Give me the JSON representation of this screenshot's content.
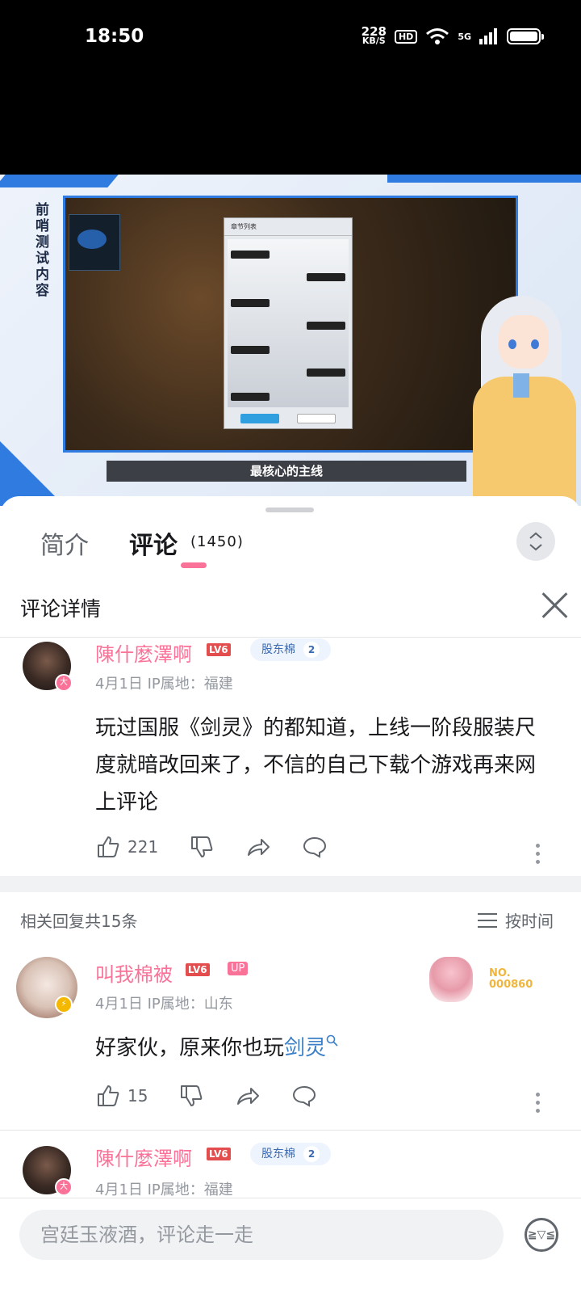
{
  "status_bar": {
    "time": "18:50",
    "net_speed": "228",
    "net_unit": "KB/S",
    "hd": "HD",
    "signal": "5G"
  },
  "video": {
    "side_title": "前哨测试内容",
    "dialog_title": "章节列表",
    "caption": "最核心的主线"
  },
  "tabs": {
    "intro": "简介",
    "comments": "评论",
    "comment_count": "(1450)"
  },
  "panel": {
    "title": "评论详情"
  },
  "main_comment": {
    "user": "陳什麼澤啊",
    "level": "LV6",
    "fan_badge": "股东棉",
    "fan_level": "2",
    "avatar_badge": "大",
    "meta": "4月1日 IP属地：福建",
    "text": "玩过国服《剑灵》的都知道，上线一阶段服装尺度就暗改回来了，不信的自己下载个游戏再来网上评论",
    "likes": "221"
  },
  "replies_header": {
    "count_text": "相关回复共15条",
    "sort_label": "按时间"
  },
  "reply_1": {
    "user": "叫我棉被",
    "level": "LV6",
    "up_tag": "UP",
    "meta": "4月1日 IP属地：山东",
    "text_prefix": "好家伙，原来你也玩",
    "text_link": "剑灵",
    "likes": "15",
    "decor_no": "NO.",
    "decor_num": "000860"
  },
  "reply_2": {
    "user": "陳什麼澤啊",
    "level": "LV6",
    "fan_badge": "股东棉",
    "fan_level": "2",
    "avatar_badge": "大",
    "meta": "4月1日 IP属地：福建"
  },
  "composer": {
    "placeholder": "宫廷玉液酒，评论走一走"
  },
  "colors": {
    "accent": "#fb7299",
    "link": "#3b7fc7",
    "brand_blue": "#2f7be0"
  }
}
